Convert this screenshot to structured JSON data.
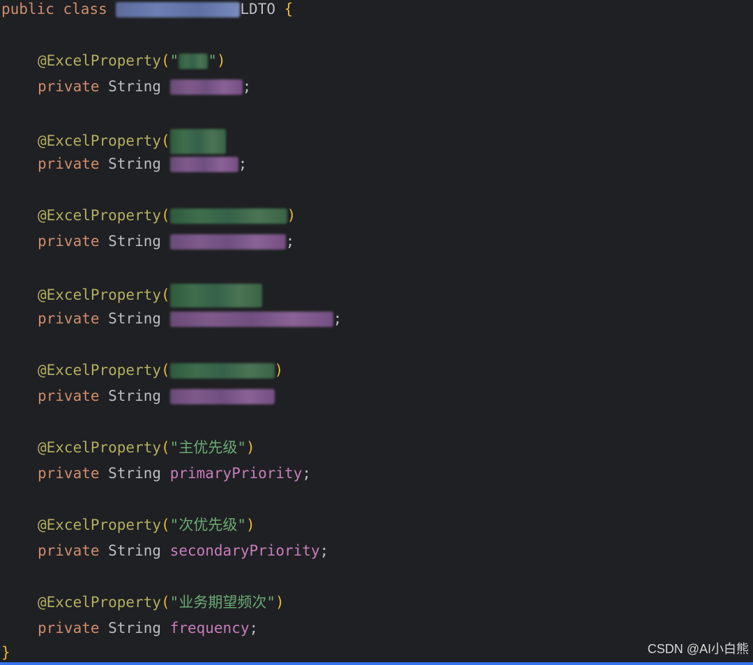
{
  "code": {
    "class_decl": {
      "public_kw": "public",
      "class_kw": "class",
      "class_suffix": "LDTO",
      "open_brace": "{"
    },
    "annotation_name": "@ExcelProperty",
    "private_kw": "private",
    "string_type": "String",
    "fields": [
      {
        "label": "",
        "name": ""
      },
      {
        "label": "",
        "name": ""
      },
      {
        "label": "",
        "name": ""
      },
      {
        "label": "",
        "name": ""
      },
      {
        "label": "",
        "name": ""
      },
      {
        "label": "\"主优先级\"",
        "name": "primaryPriority"
      },
      {
        "label": "\"次优先级\"",
        "name": "secondaryPriority"
      },
      {
        "label": "\"业务期望频次\"",
        "name": "frequency"
      }
    ],
    "close_brace": "}"
  },
  "watermark": "CSDN @AI小白熊",
  "colors": {
    "background": "#1f2023",
    "keyword": "#cf8e6d",
    "annotation": "#b3ae60",
    "string": "#6aab73",
    "field": "#c77dbb",
    "brace": "#e8ba36"
  }
}
